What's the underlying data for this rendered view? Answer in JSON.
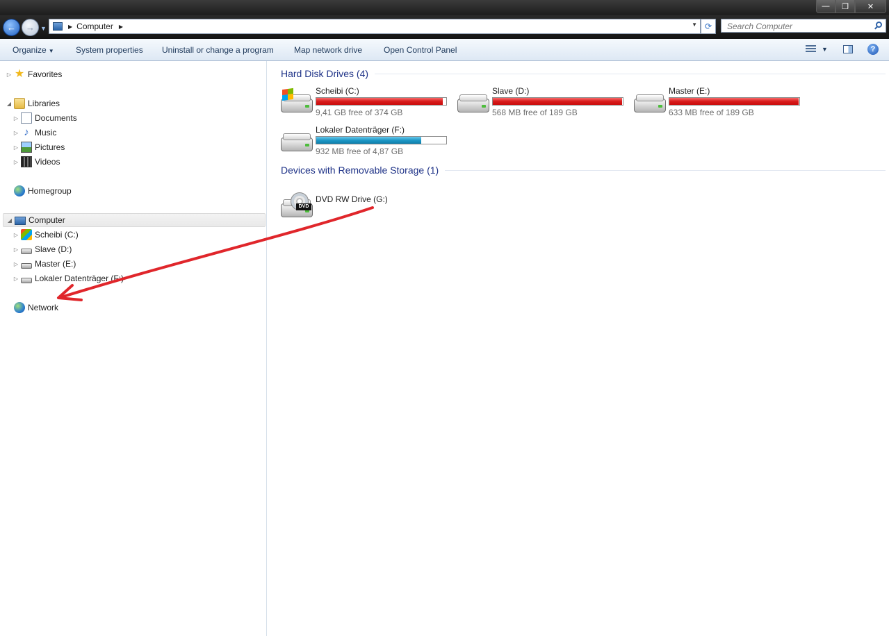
{
  "window": {
    "minimize": "—",
    "maximize": "❐",
    "close": "✕"
  },
  "navigation": {
    "back_glyph": "←",
    "forward_glyph": "→",
    "address": {
      "crumbs": [
        "Computer"
      ]
    },
    "search_placeholder": "Search Computer"
  },
  "toolbar": {
    "organize": "Organize",
    "system_properties": "System properties",
    "uninstall": "Uninstall or change a program",
    "map_drive": "Map network drive",
    "control_panel": "Open Control Panel",
    "help": "?"
  },
  "nav_pane": {
    "favorites": "Favorites",
    "libraries": "Libraries",
    "library_items": [
      "Documents",
      "Music",
      "Pictures",
      "Videos"
    ],
    "homegroup": "Homegroup",
    "computer": "Computer",
    "computer_items": [
      "Scheibi (C:)",
      "Slave (D:)",
      "Master (E:)",
      "Lokaler Datenträger (F:)"
    ],
    "network": "Network"
  },
  "content": {
    "hard_disk_group": "Hard Disk Drives (4)",
    "drives": [
      {
        "name": "Scheibi (C:)",
        "free": "9,41 GB free of 374 GB",
        "used_fraction": 0.975,
        "bar_color": "red",
        "icon": "windows-drive-icon"
      },
      {
        "name": "Slave (D:)",
        "free": "568 MB free of 189 GB",
        "used_fraction": 0.997,
        "bar_color": "red",
        "icon": "hard-drive-icon"
      },
      {
        "name": "Master (E:)",
        "free": "633 MB free of 189 GB",
        "used_fraction": 0.997,
        "bar_color": "red",
        "icon": "hard-drive-icon"
      },
      {
        "name": "Lokaler Datenträger (F:)",
        "free": "932 MB free of 4,87 GB",
        "used_fraction": 0.81,
        "bar_color": "blue",
        "icon": "hard-drive-icon"
      }
    ],
    "removable_group": "Devices with Removable Storage (1)",
    "removable": [
      {
        "name": "DVD RW Drive (G:)",
        "icon": "dvd-drive-icon",
        "badge": "DVD"
      }
    ]
  },
  "colors": {
    "bar_red": "#d81b1b",
    "bar_blue": "#1e98c6",
    "group_heading": "#1e3287",
    "annotation_arrow": "#e0262b"
  }
}
